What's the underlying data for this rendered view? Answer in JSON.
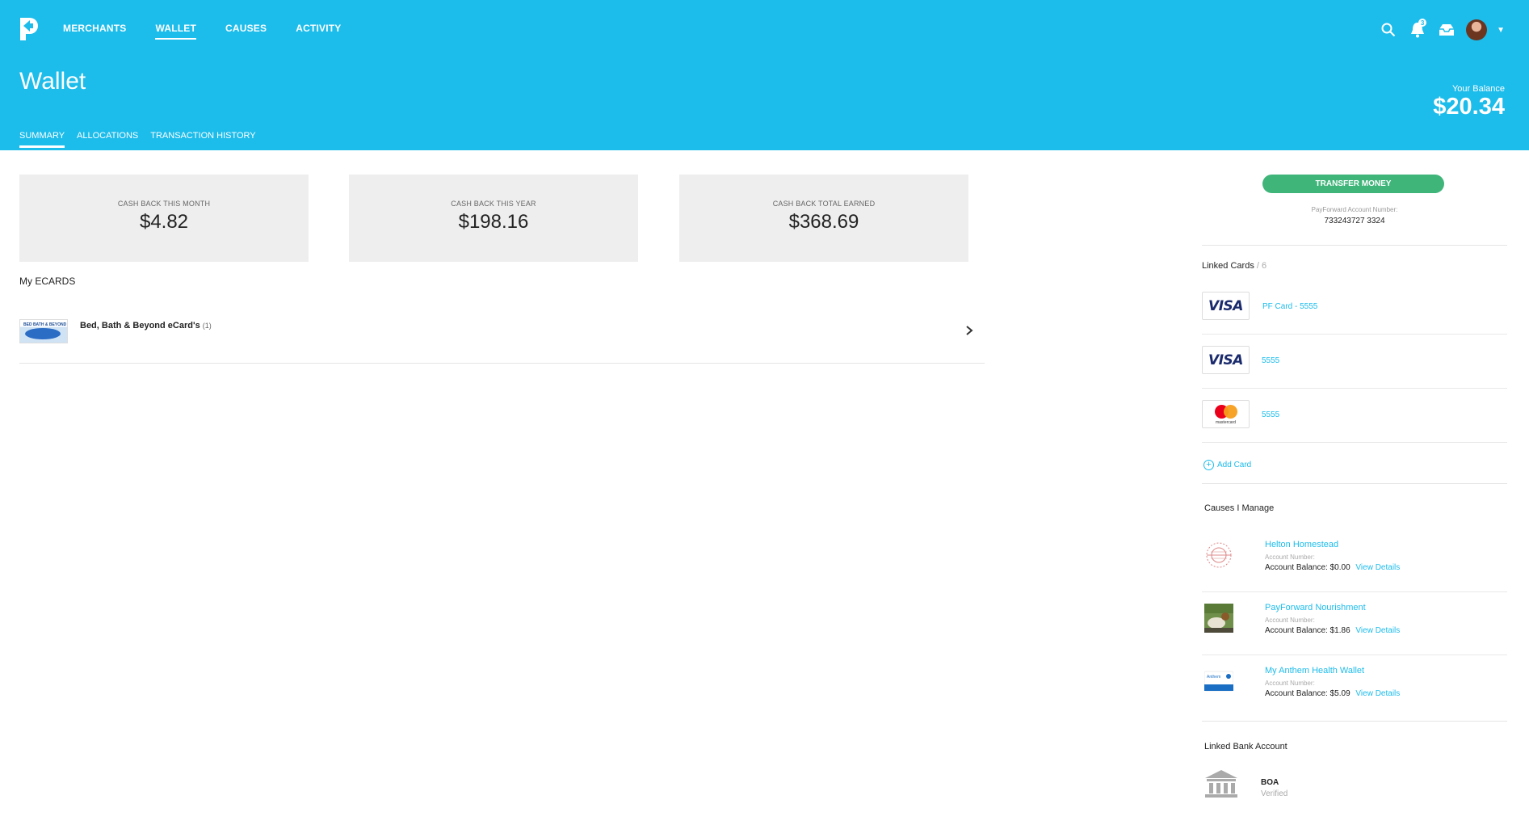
{
  "nav": {
    "items": [
      {
        "label": "MERCHANTS",
        "active": false
      },
      {
        "label": "WALLET",
        "active": true
      },
      {
        "label": "CAUSES",
        "active": false
      },
      {
        "label": "ACTIVITY",
        "active": false
      }
    ],
    "notification_count": "3"
  },
  "header": {
    "title": "Wallet",
    "tabs": [
      {
        "label": "SUMMARY",
        "active": true
      },
      {
        "label": "ALLOCATIONS",
        "active": false
      },
      {
        "label": "TRANSACTION HISTORY",
        "active": false
      }
    ],
    "balance_label": "Your Balance",
    "balance_value": "$20.34"
  },
  "stats": [
    {
      "label": "CASH BACK THIS MONTH",
      "value": "$4.82"
    },
    {
      "label": "CASH BACK THIS YEAR",
      "value": "$198.16"
    },
    {
      "label": "CASH BACK TOTAL EARNED",
      "value": "$368.69"
    }
  ],
  "ecards": {
    "title": "My ECARDS",
    "items": [
      {
        "name": "Bed, Bath & Beyond eCard's",
        "count": "(1)",
        "thumb_text": "BED BATH & BEYOND"
      }
    ]
  },
  "sidebar": {
    "transfer_label": "TRANSFER MONEY",
    "account_label": "PayForward Account Number:",
    "account_number": "733243727 3324",
    "linked_cards_title": "Linked Cards",
    "linked_cards_count": " / 6",
    "cards": [
      {
        "brand": "VISA",
        "label": "PF Card - 5555"
      },
      {
        "brand": "VISA",
        "label": "5555"
      },
      {
        "brand": "mastercard",
        "label": "5555"
      }
    ],
    "add_card_label": "Add Card",
    "causes_title": "Causes I Manage",
    "causes": [
      {
        "name": "Helton Homestead",
        "account_label": "Account Number:",
        "balance_label": "Account Balance:",
        "balance": "$0.00",
        "view_details": "View Details"
      },
      {
        "name": "PayForward Nourishment",
        "account_label": "Account Number:",
        "balance_label": "Account Balance:",
        "balance": "$1.86",
        "view_details": "View Details"
      },
      {
        "name": "My Anthem Health Wallet",
        "account_label": "Account Number:",
        "balance_label": "Account Balance:",
        "balance": "$5.09",
        "view_details": "View Details"
      }
    ],
    "bank_title": "Linked Bank Account",
    "bank_name": "BOA",
    "bank_status": "Verified"
  },
  "colors": {
    "brand": "#1cbceb",
    "transfer_button": "#3fb57a",
    "stat_background": "#eeeeee"
  },
  "icons": [
    "payforward-logo",
    "search-icon",
    "bell-icon",
    "inbox-icon",
    "chevron-down-icon",
    "chevron-right-icon",
    "plus-circle-icon",
    "bank-icon"
  ]
}
